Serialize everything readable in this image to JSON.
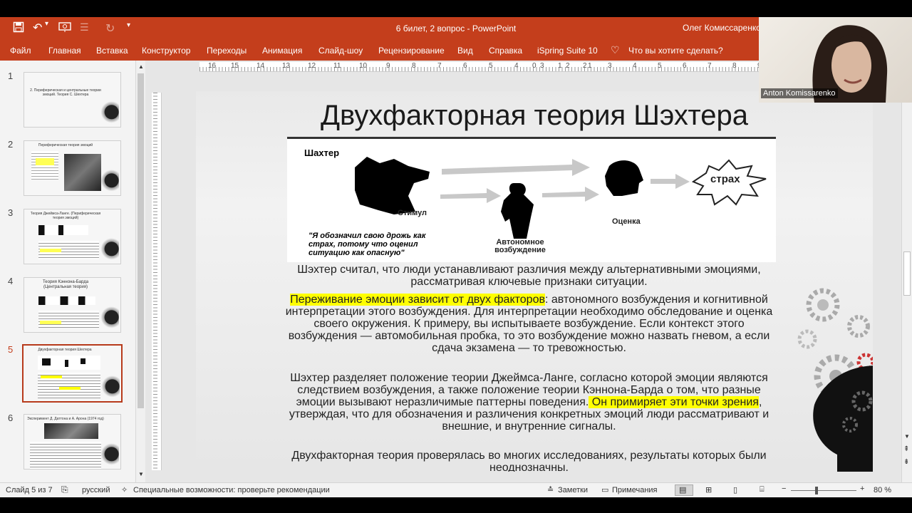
{
  "app": {
    "doc_title": "6 билет, 2 вопрос  -  PowerPoint",
    "user": "Олег Комиссаренко",
    "accent": "#c43e1c"
  },
  "ribbon_tabs": [
    "Файл",
    "Главная",
    "Вставка",
    "Конструктор",
    "Переходы",
    "Анимация",
    "Слайд-шоу",
    "Рецензирование",
    "Вид",
    "Справка",
    "iSpring Suite 10"
  ],
  "tell_me": "Что вы хотите сделать?",
  "ruler": {
    "h_ticks": [
      "16",
      "15",
      "14",
      "13",
      "12",
      "11",
      "10",
      "9",
      "8",
      "7",
      "6",
      "5",
      "4",
      "3",
      "2",
      "1",
      "0",
      "1",
      "2",
      "3",
      "4",
      "5",
      "6",
      "7",
      "8",
      "9",
      "10",
      "11"
    ]
  },
  "thumbnails": [
    {
      "num": "1",
      "text": "2. Периферическая и центральные теории эмоций. Теория С. Шехтера"
    },
    {
      "num": "2",
      "text": "Периферическая теория эмоций"
    },
    {
      "num": "3",
      "text": "Теория Джеймса-Ланге. (Периферическая теория эмоций)"
    },
    {
      "num": "4",
      "text": "Теория Кэннона-Барда (Центральная теория)"
    },
    {
      "num": "5",
      "text": "Двухфакторная теория Шехтера"
    },
    {
      "num": "6",
      "text": "Эксперимент Д. Даттона и А. Арона (1974 год)"
    }
  ],
  "slide": {
    "title": "Двухфакторная теория Шэхтера",
    "figure": {
      "heading": "Шахтер",
      "stimulus": "Стимул",
      "arousal": "Автономное возбуждение",
      "appraisal": "Оценка",
      "fear": "страх",
      "quote": "\"Я обозначил свою дрожь как страх, потому что оценил ситуацию как опасную\""
    },
    "p1": "Шэхтер считал, что люди устанавливают различия между альтернативными эмоциями, рассматривая ключевые признаки ситуации.",
    "p2_highlight": "Переживание эмоции зависит от двух факторов",
    "p2_rest": ": автономного возбуждения и когнитивной интерпретации этого возбуждения. Для интерпретации необходимо обследование и оценка своего окружения. К примеру, вы испытываете возбуждение. Если контекст этого возбуждения — автомобильная пробка, то это возбуждение можно назвать гневом, а если сдача экзамена — то тревожностью.",
    "p3_a": "Шэхтер разделяет положение теории Джеймса-Ланге, согласно которой эмоции являются следствием возбуждения, а также положение теории Кэннона-Барда о том, что разные эмоции вызывают неразличимые паттерны поведения.",
    "p3_highlight": " Он примиряет эти точки зрения",
    "p3_b": ", утверждая, что для обозначения и различения конкретных эмоций люди рассматривают и внешние, и внутренние сигналы.",
    "p4": "Двухфакторная теория проверялась во многих исследованиях, результаты которых были неоднозначны."
  },
  "status": {
    "slide_of": "Слайд 5 из 7",
    "lang": "русский",
    "accessibility": "Специальные возможности: проверьте рекомендации",
    "notes": "Заметки",
    "comments": "Примечания",
    "zoom": "80 %",
    "zoom_level_pct": 80
  },
  "webcam": {
    "name": "Anton Komissarenko"
  }
}
